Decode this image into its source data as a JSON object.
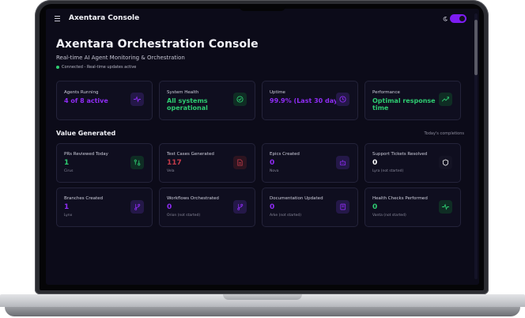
{
  "app": {
    "title": "Axentara Console"
  },
  "header": {
    "title": "Axentara Orchestration Console",
    "subtitle": "Real-time AI Agent Monitoring & Orchestration",
    "status": "Connected - Real-time updates active"
  },
  "stats": [
    {
      "label": "Agents Running",
      "value": "4 of 8 active",
      "color": "#8f2cf5",
      "icon": "activity-icon"
    },
    {
      "label": "System Health",
      "value": "All systems operational",
      "color": "#2ecc71",
      "icon": "check-circle-icon"
    },
    {
      "label": "Uptime",
      "value": "99.9% (Last 30 days)",
      "color": "#8f2cf5",
      "icon": "clock-icon"
    },
    {
      "label": "Performance",
      "value": "Optimal response time",
      "color": "#2ecc71",
      "icon": "trending-up-icon"
    }
  ],
  "value_section": {
    "title": "Value Generated",
    "note": "Today's completions"
  },
  "value_cards": [
    {
      "label": "PRs Reviewed Today",
      "value": "1",
      "agent": "Cirus",
      "color": "#2ecc71",
      "icon": "git-compare-icon"
    },
    {
      "label": "Test Cases Generated",
      "value": "117",
      "agent": "Vela",
      "color": "#c43b4a",
      "icon": "file-icon"
    },
    {
      "label": "Epics Created",
      "value": "0",
      "agent": "Nova",
      "color": "#8f2cf5",
      "icon": "bot-icon"
    },
    {
      "label": "Support Tickets Resolved",
      "value": "0",
      "agent": "Lyra (not started)",
      "color": "#ffffff",
      "icon": "shield-icon"
    },
    {
      "label": "Branches Created",
      "value": "1",
      "agent": "Lynx",
      "color": "#8f2cf5",
      "icon": "git-branch-icon"
    },
    {
      "label": "Workflows Orchestrated",
      "value": "0",
      "agent": "Orion (not started)",
      "color": "#8f2cf5",
      "icon": "git-branch-icon"
    },
    {
      "label": "Documentation Updated",
      "value": "0",
      "agent": "Arke (not started)",
      "color": "#8f2cf5",
      "icon": "book-icon"
    },
    {
      "label": "Health Checks Performed",
      "value": "0",
      "agent": "Vanta (not started)",
      "color": "#2ecc71",
      "icon": "activity-icon"
    }
  ],
  "theme_toggle": {
    "state": "dark"
  }
}
